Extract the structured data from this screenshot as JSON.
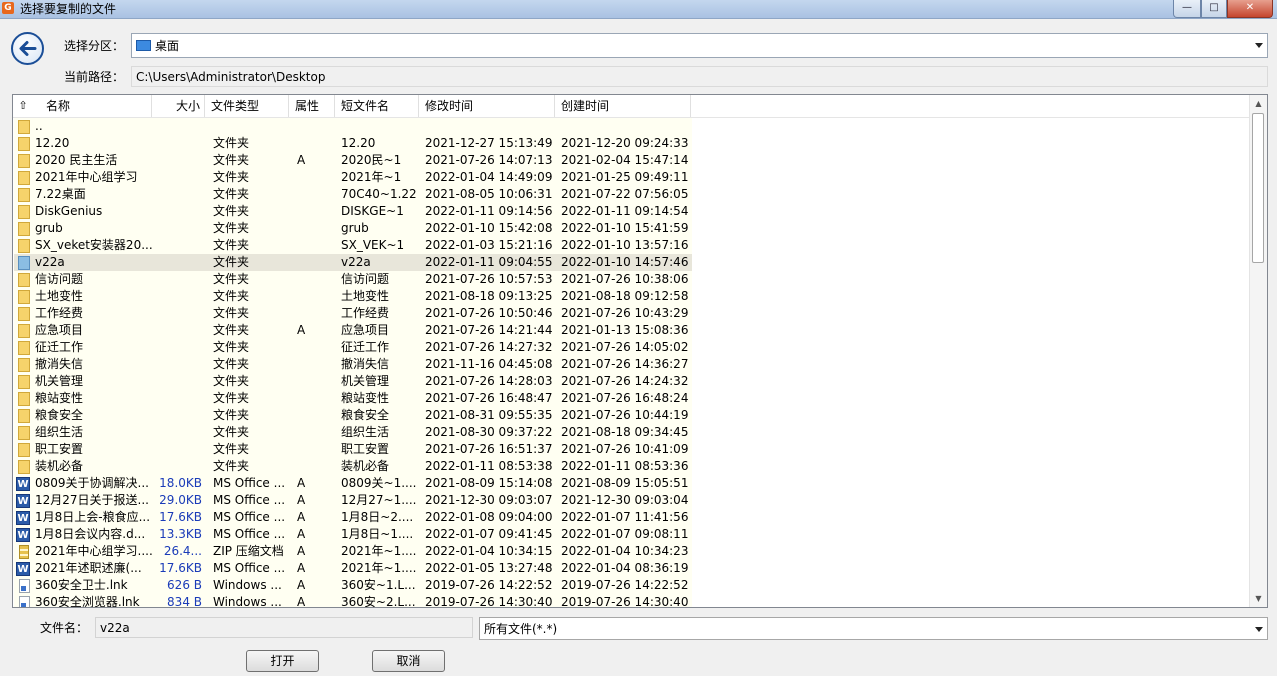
{
  "window": {
    "title": "选择要复制的文件",
    "app_icon_letter": "G",
    "buttons": {
      "minimize": "—",
      "maximize": "□",
      "close": "✕"
    }
  },
  "nav": {
    "back_icon": "back-arrow-icon",
    "partition_label": "选择分区：",
    "partition_value": "桌面",
    "path_label": "当前路径：",
    "path_value": "C:\\Users\\Administrator\\Desktop"
  },
  "columns": {
    "name": "名称",
    "size": "大小",
    "type": "文件类型",
    "attr": "属性",
    "short": "短文件名",
    "modified": "修改时间",
    "created": "创建时间"
  },
  "files": [
    {
      "icon": "folder",
      "name": "..",
      "size": "",
      "type": "",
      "attr": "",
      "short": "",
      "modified": "",
      "created": ""
    },
    {
      "icon": "folder",
      "name": "12.20",
      "size": "",
      "type": "文件夹",
      "attr": "",
      "short": "12.20",
      "modified": "2021-12-27 15:13:49",
      "created": "2021-12-20 09:24:33"
    },
    {
      "icon": "folder",
      "name": "2020 民主生活",
      "size": "",
      "type": "文件夹",
      "attr": "A",
      "short": "2020民~1",
      "modified": "2021-07-26 14:07:13",
      "created": "2021-02-04 15:47:14"
    },
    {
      "icon": "folder",
      "name": "2021年中心组学习",
      "size": "",
      "type": "文件夹",
      "attr": "",
      "short": "2021年~1",
      "modified": "2022-01-04 14:49:09",
      "created": "2021-01-25 09:49:11"
    },
    {
      "icon": "folder",
      "name": "7.22桌面",
      "size": "",
      "type": "文件夹",
      "attr": "",
      "short": "70C40~1.22",
      "modified": "2021-08-05 10:06:31",
      "created": "2021-07-22 07:56:05"
    },
    {
      "icon": "folder",
      "name": "DiskGenius",
      "size": "",
      "type": "文件夹",
      "attr": "",
      "short": "DISKGE~1",
      "modified": "2022-01-11 09:14:56",
      "created": "2022-01-11 09:14:54"
    },
    {
      "icon": "folder",
      "name": "grub",
      "size": "",
      "type": "文件夹",
      "attr": "",
      "short": "grub",
      "modified": "2022-01-10 15:42:08",
      "created": "2022-01-10 15:41:59"
    },
    {
      "icon": "folder",
      "name": "SX_veket安装器20...",
      "size": "",
      "type": "文件夹",
      "attr": "",
      "short": "SX_VEK~1",
      "modified": "2022-01-03 15:21:16",
      "created": "2022-01-10 13:57:16"
    },
    {
      "icon": "folder-selected",
      "name": "v22a",
      "size": "",
      "type": "文件夹",
      "attr": "",
      "short": "v22a",
      "modified": "2022-01-11 09:04:55",
      "created": "2022-01-10 14:57:46",
      "selected": true
    },
    {
      "icon": "folder",
      "name": "信访问题",
      "size": "",
      "type": "文件夹",
      "attr": "",
      "short": "信访问题",
      "modified": "2021-07-26 10:57:53",
      "created": "2021-07-26 10:38:06"
    },
    {
      "icon": "folder",
      "name": "土地变性",
      "size": "",
      "type": "文件夹",
      "attr": "",
      "short": "土地变性",
      "modified": "2021-08-18 09:13:25",
      "created": "2021-08-18 09:12:58"
    },
    {
      "icon": "folder",
      "name": "工作经费",
      "size": "",
      "type": "文件夹",
      "attr": "",
      "short": "工作经费",
      "modified": "2021-07-26 10:50:46",
      "created": "2021-07-26 10:43:29"
    },
    {
      "icon": "folder",
      "name": "应急项目",
      "size": "",
      "type": "文件夹",
      "attr": "A",
      "short": "应急项目",
      "modified": "2021-07-26 14:21:44",
      "created": "2021-01-13 15:08:36"
    },
    {
      "icon": "folder",
      "name": "征迁工作",
      "size": "",
      "type": "文件夹",
      "attr": "",
      "short": "征迁工作",
      "modified": "2021-07-26 14:27:32",
      "created": "2021-07-26 14:05:02"
    },
    {
      "icon": "folder",
      "name": "撤消失信",
      "size": "",
      "type": "文件夹",
      "attr": "",
      "short": "撤消失信",
      "modified": "2021-11-16 04:45:08",
      "created": "2021-07-26 14:36:27"
    },
    {
      "icon": "folder",
      "name": "机关管理",
      "size": "",
      "type": "文件夹",
      "attr": "",
      "short": "机关管理",
      "modified": "2021-07-26 14:28:03",
      "created": "2021-07-26 14:24:32"
    },
    {
      "icon": "folder",
      "name": "粮站变性",
      "size": "",
      "type": "文件夹",
      "attr": "",
      "short": "粮站变性",
      "modified": "2021-07-26 16:48:47",
      "created": "2021-07-26 16:48:24"
    },
    {
      "icon": "folder",
      "name": "粮食安全",
      "size": "",
      "type": "文件夹",
      "attr": "",
      "short": "粮食安全",
      "modified": "2021-08-31 09:55:35",
      "created": "2021-07-26 10:44:19"
    },
    {
      "icon": "folder",
      "name": "组织生活",
      "size": "",
      "type": "文件夹",
      "attr": "",
      "short": "组织生活",
      "modified": "2021-08-30 09:37:22",
      "created": "2021-08-18 09:34:45"
    },
    {
      "icon": "folder",
      "name": "职工安置",
      "size": "",
      "type": "文件夹",
      "attr": "",
      "short": "职工安置",
      "modified": "2021-07-26 16:51:37",
      "created": "2021-07-26 10:41:09"
    },
    {
      "icon": "folder",
      "name": "装机必备",
      "size": "",
      "type": "文件夹",
      "attr": "",
      "short": "装机必备",
      "modified": "2022-01-11 08:53:38",
      "created": "2022-01-11 08:53:36"
    },
    {
      "icon": "word",
      "name": "0809关于协调解决...",
      "size": "18.0KB",
      "type": "MS Office ...",
      "attr": "A",
      "short": "0809关~1....",
      "modified": "2021-08-09 15:14:08",
      "created": "2021-08-09 15:05:51"
    },
    {
      "icon": "word",
      "name": "12月27日关于报送...",
      "size": "29.0KB",
      "type": "MS Office ...",
      "attr": "A",
      "short": "12月27~1....",
      "modified": "2021-12-30 09:03:07",
      "created": "2021-12-30 09:03:04"
    },
    {
      "icon": "word",
      "name": "1月8日上会-粮食应...",
      "size": "17.6KB",
      "type": "MS Office ...",
      "attr": "A",
      "short": "1月8日~2....",
      "modified": "2022-01-08 09:04:00",
      "created": "2022-01-07 11:41:56"
    },
    {
      "icon": "word",
      "name": "1月8日会议内容.d...",
      "size": "13.3KB",
      "type": "MS Office ...",
      "attr": "A",
      "short": "1月8日~1....",
      "modified": "2022-01-07 09:41:45",
      "created": "2022-01-07 09:08:11"
    },
    {
      "icon": "zip",
      "name": "2021年中心组学习....",
      "size": "26.4...",
      "type": "ZIP 压缩文档",
      "attr": "A",
      "short": "2021年~1....",
      "modified": "2022-01-04 10:34:15",
      "created": "2022-01-04 10:34:23"
    },
    {
      "icon": "word",
      "name": "2021年述职述廉(...",
      "size": "17.6KB",
      "type": "MS Office ...",
      "attr": "A",
      "short": "2021年~1....",
      "modified": "2022-01-05 13:27:48",
      "created": "2022-01-04 08:36:19"
    },
    {
      "icon": "lnk",
      "name": "360安全卫士.lnk",
      "size": "626 B",
      "type": "Windows ...",
      "attr": "A",
      "short": "360安~1.L...",
      "modified": "2019-07-26 14:22:52",
      "created": "2019-07-26 14:22:52"
    },
    {
      "icon": "lnk",
      "name": "360安全浏览器.lnk",
      "size": "834 B",
      "type": "Windows ...",
      "attr": "A",
      "short": "360安~2.L...",
      "modified": "2019-07-26 14:30:40",
      "created": "2019-07-26 14:30:40"
    }
  ],
  "footer": {
    "filename_label": "文件名：",
    "filename_value": "v22a",
    "filter_value": "所有文件(*.*)",
    "open_button": "打开",
    "cancel_button": "取消"
  },
  "icons": {
    "folder": "folder-icon",
    "word": "word-doc-icon",
    "zip": "zip-archive-icon",
    "lnk": "shortcut-icon",
    "drive": "desktop-icon"
  },
  "colors": {
    "list_background": "#fffff2",
    "selected_row": "#e8e6da",
    "size_text": "#1a3bb8",
    "back_button_ring": "#1b4e97"
  }
}
